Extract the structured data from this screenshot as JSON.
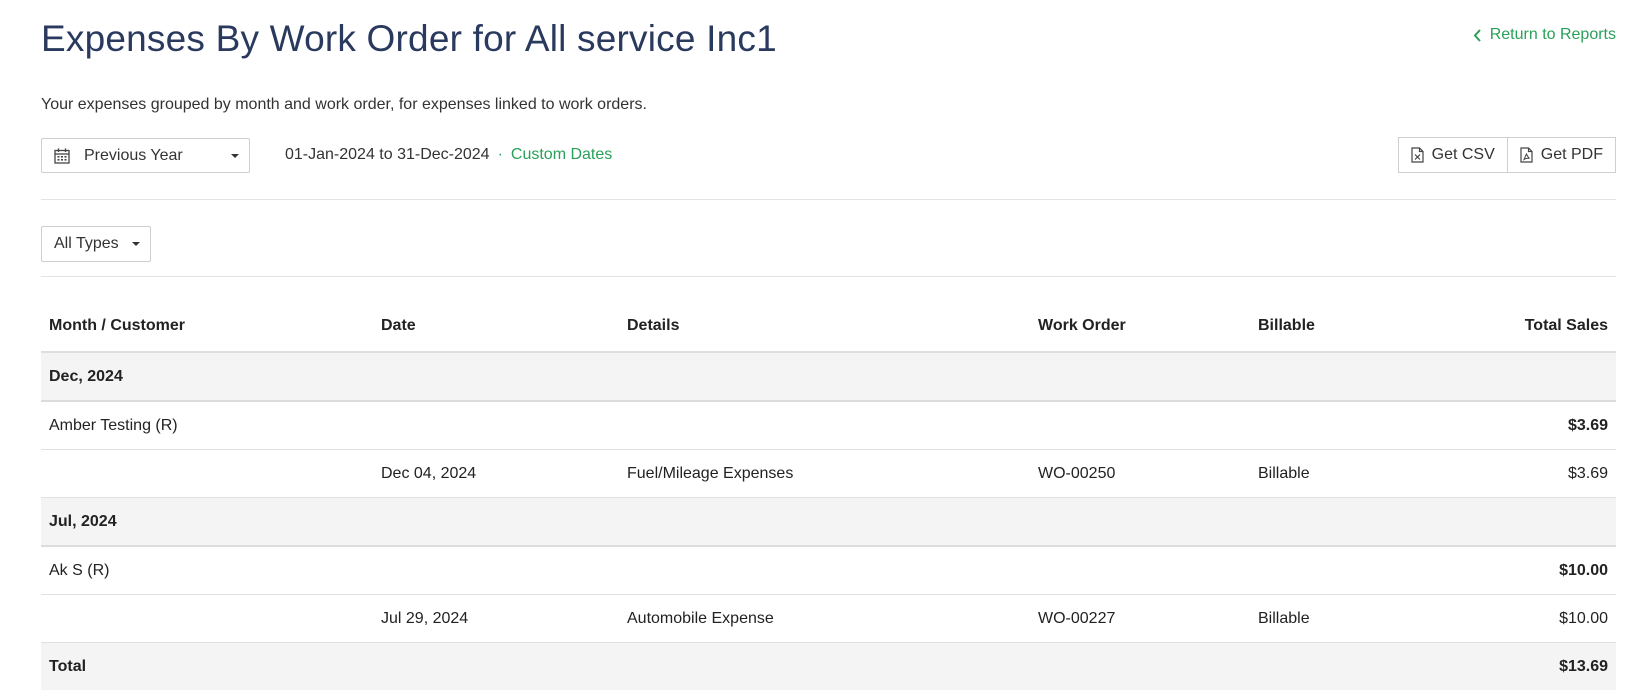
{
  "header": {
    "title": "Expenses By Work Order for All service Inc1",
    "return_link": "Return to Reports",
    "subtitle": "Your expenses grouped by month and work order, for expenses linked to work orders."
  },
  "filters": {
    "period": "Previous Year",
    "date_range": "01-Jan-2024 to 31-Dec-2024",
    "separator": "·",
    "custom_dates": "Custom Dates",
    "types": "All Types"
  },
  "actions": {
    "csv": "Get CSV",
    "pdf": "Get PDF"
  },
  "table": {
    "headers": [
      "Month / Customer",
      "Date",
      "Details",
      "Work Order",
      "Billable",
      "Total Sales"
    ],
    "groups": [
      {
        "month": "Dec, 2024",
        "customer": "Amber Testing (R)",
        "customer_total": "$3.69",
        "entry": {
          "date": "Dec 04, 2024",
          "details": "Fuel/Mileage Expenses",
          "work_order": "WO-00250",
          "billable": "Billable",
          "amount": "$3.69"
        }
      },
      {
        "month": "Jul, 2024",
        "customer": "Ak S (R)",
        "customer_total": "$10.00",
        "entry": {
          "date": "Jul 29, 2024",
          "details": "Automobile Expense",
          "work_order": "WO-00227",
          "billable": "Billable",
          "amount": "$10.00"
        }
      }
    ],
    "total_label": "Total",
    "total_value": "$13.69"
  },
  "colors": {
    "title": "#2a3a5e",
    "accent": "#2aa05a",
    "row_shade": "#f4f4f4"
  }
}
